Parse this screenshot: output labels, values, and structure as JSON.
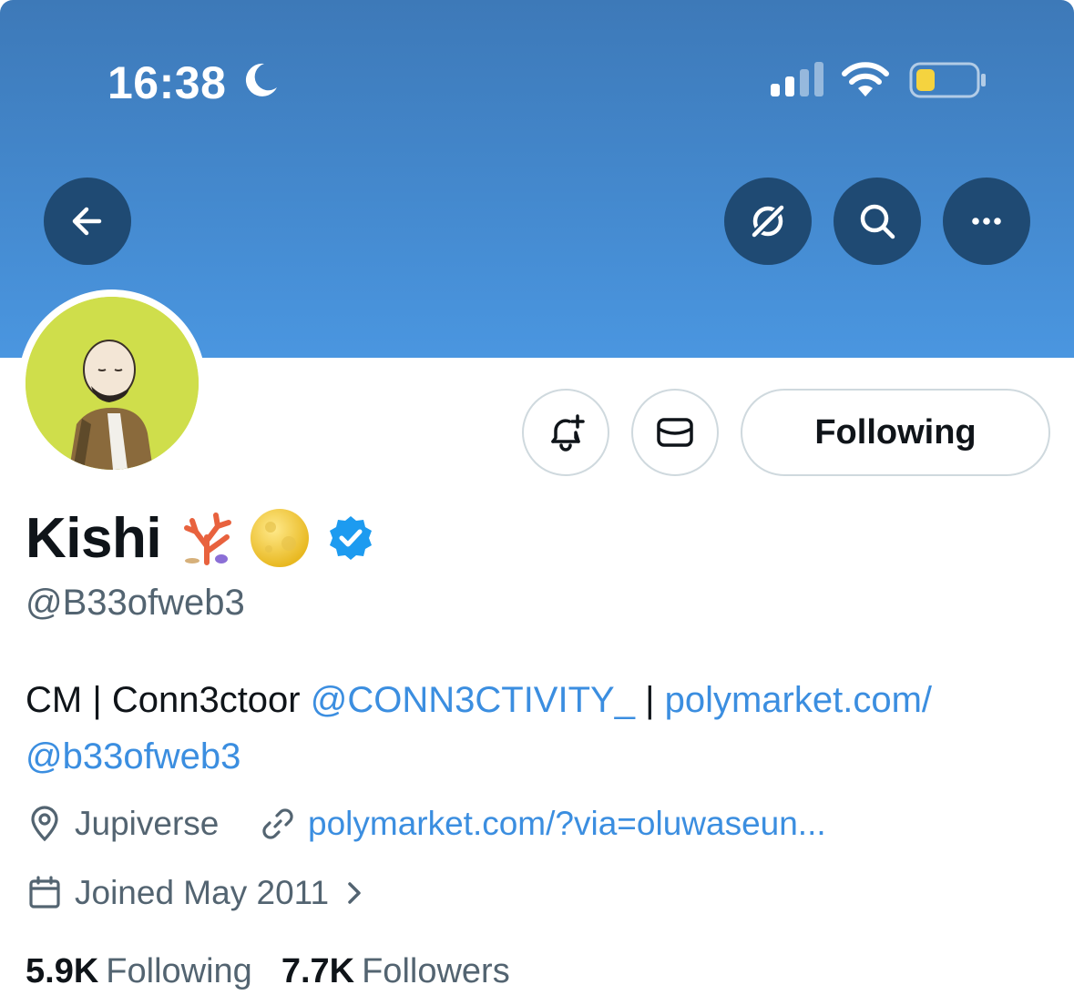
{
  "status_bar": {
    "time": "16:38",
    "icons": [
      "moon-icon",
      "signal-icon",
      "wifi-icon",
      "battery-icon"
    ]
  },
  "banner": {
    "color_top": "#3d79b8",
    "color_bottom": "#4a96e0"
  },
  "header_buttons": {
    "back": "back-arrow-icon",
    "grok": "grok-icon",
    "search": "search-icon",
    "more": "more-icon"
  },
  "actions": {
    "notify_icon": "bell-plus-icon",
    "message_icon": "envelope-icon",
    "following_label": "Following"
  },
  "profile": {
    "name": "Kishi",
    "name_emojis": [
      "coral-icon",
      "full-moon-icon"
    ],
    "verified": true,
    "handle": "@B33ofweb3",
    "bio": {
      "text": "CM | Conn3ctoor",
      "mention": "@CONN3CTIVITY_",
      "separator": "|",
      "link_line1": "polymarket.com/",
      "link_line2": "@b33ofweb3"
    },
    "location": "Jupiverse",
    "website": "polymarket.com/?via=oluwaseun...",
    "joined": "Joined May 2011"
  },
  "stats": {
    "following_count": "5.9K",
    "following_label": "Following",
    "followers_count": "7.7K",
    "followers_label": "Followers"
  },
  "colors": {
    "accent": "#1d9bf0",
    "secondary_text": "#536471",
    "verified": "#1d9bf0",
    "header_button_bg": "#1f4a73"
  }
}
